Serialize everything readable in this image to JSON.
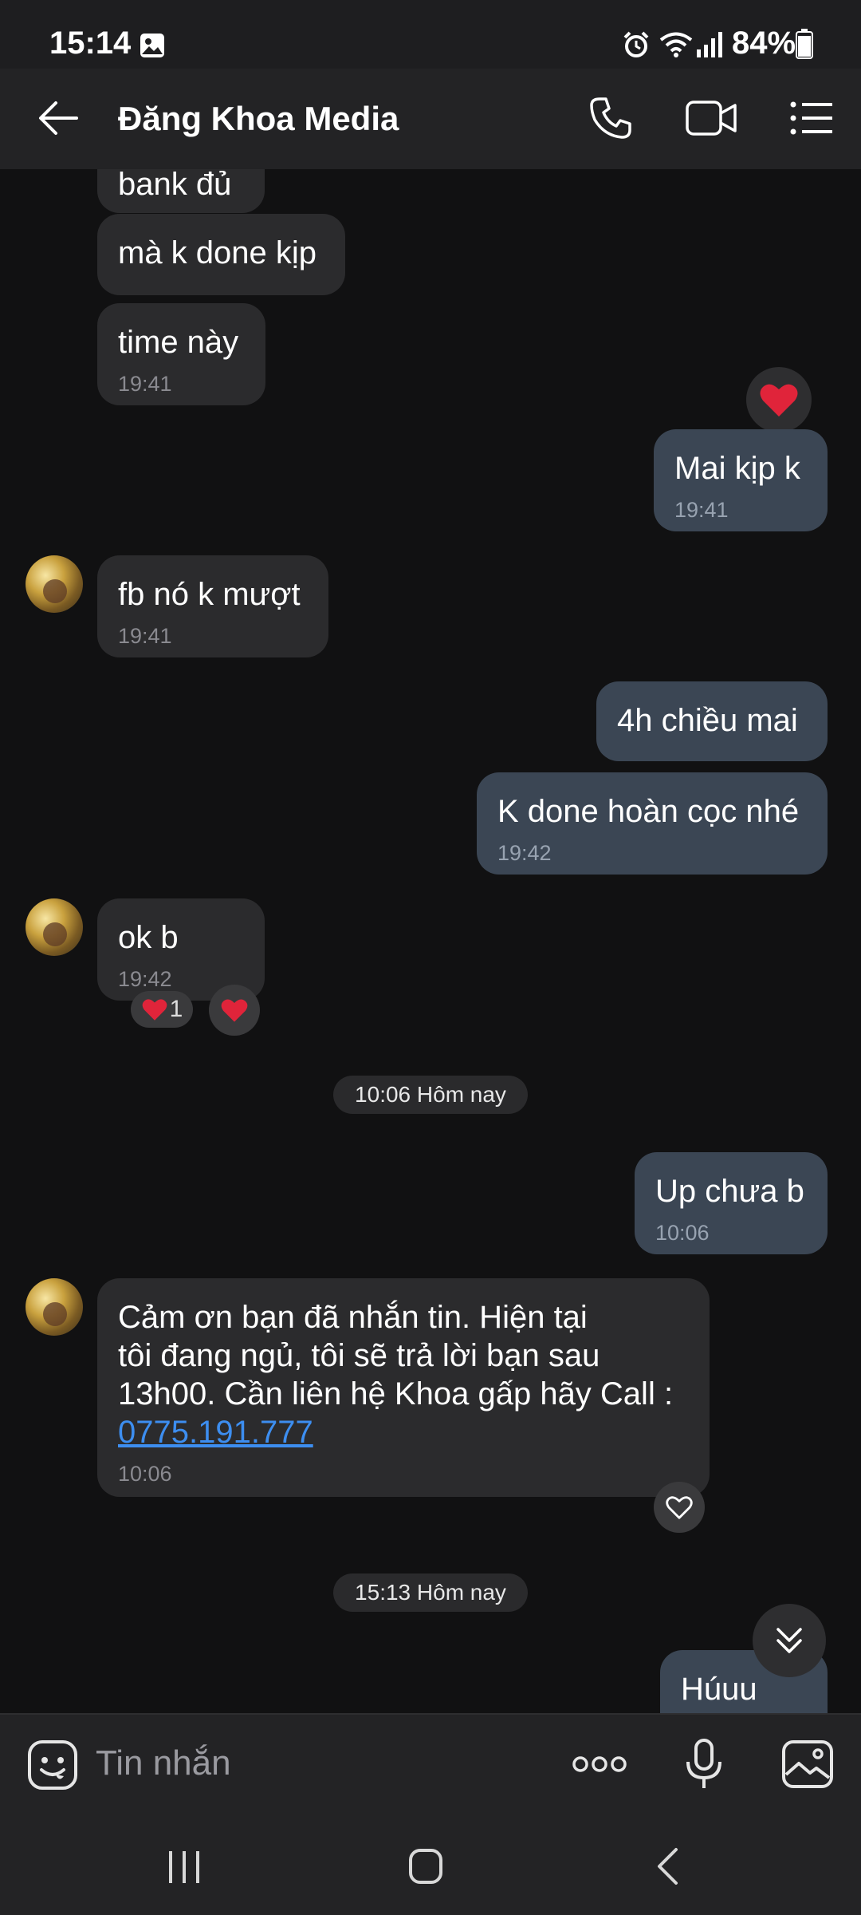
{
  "status_bar": {
    "time": "15:14",
    "battery": "84%"
  },
  "header": {
    "title": "Đăng Khoa Media"
  },
  "messages": [
    {
      "text": "bank đủ",
      "time": ""
    },
    {
      "text": "mà k done kịp",
      "time": ""
    },
    {
      "text": "time này",
      "time": "19:41"
    },
    {
      "text": "Mai kịp k",
      "time": "19:41"
    },
    {
      "text": "fb nó k mượt",
      "time": "19:41"
    },
    {
      "text": "4h chiều mai",
      "time": ""
    },
    {
      "text": "K done hoàn cọc nhé",
      "time": "19:42"
    },
    {
      "text": "ok b",
      "time": "19:42",
      "reaction_count": "1"
    },
    {
      "text": "Up chưa b",
      "time": "10:06"
    },
    {
      "text_line1": "Cảm ơn bạn đã nhắn tin. Hiện tại",
      "text_line2": "tôi đang ngủ, tôi sẽ trả lời bạn sau",
      "text_line3": "13h00. Cần liên hệ Khoa gấp hãy Call :",
      "link": "0775.191.777",
      "time": "10:06"
    },
    {
      "text": "Húuu",
      "time": ""
    }
  ],
  "dates": [
    "10:06 Hôm nay",
    "15:13 Hôm nay"
  ],
  "composer": {
    "placeholder": "Tin nhắn"
  },
  "icons": {
    "back": "arrow-left-icon",
    "call": "phone-icon",
    "video": "video-camera-icon",
    "menu": "list-icon",
    "emoji": "emoji-icon",
    "more": "more-dots-icon",
    "mic": "microphone-icon",
    "gallery": "image-icon",
    "scroll": "chevron-double-down-icon"
  },
  "colors": {
    "incoming": "#2b2b2d",
    "outgoing": "#3b4654",
    "link": "#3d8ef0",
    "heart": "#e0243a"
  }
}
